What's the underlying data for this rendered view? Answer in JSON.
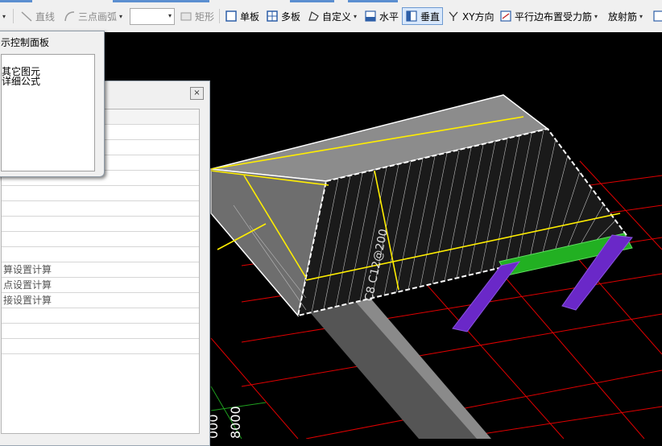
{
  "toolbar": {
    "line_label": "直线",
    "arc_label": "三点画弧",
    "rect_label": "矩形",
    "single_slab_label": "单板",
    "multi_slab_label": "多板",
    "custom_label": "自定义",
    "horizontal_label": "水平",
    "vertical_label": "垂直",
    "xy_label": "XY方向",
    "parallel_edge_label": "平行边布置受力筋",
    "radial_label": "放射筋"
  },
  "control_panel": {
    "title": "示控制面板",
    "line1": "其它图元",
    "line2": "详细公式"
  },
  "property_panel": {
    "close_glyph": "×",
    "rows": [
      "",
      "",
      "",
      "",
      "",
      "",
      "",
      "",
      "",
      "算设置计算",
      "点设置计算",
      "接设置计算",
      "",
      "",
      ""
    ]
  },
  "drawing": {
    "rebar_label": "C8 C12@200",
    "axis_labels": [
      "000",
      "8000"
    ]
  },
  "colors": {
    "scene_bg": "#000000",
    "grid_red": "#e00000",
    "rebar_yellow": "#ffee00",
    "column_purple": "#6a28c8",
    "beam_green": "#22b022"
  }
}
